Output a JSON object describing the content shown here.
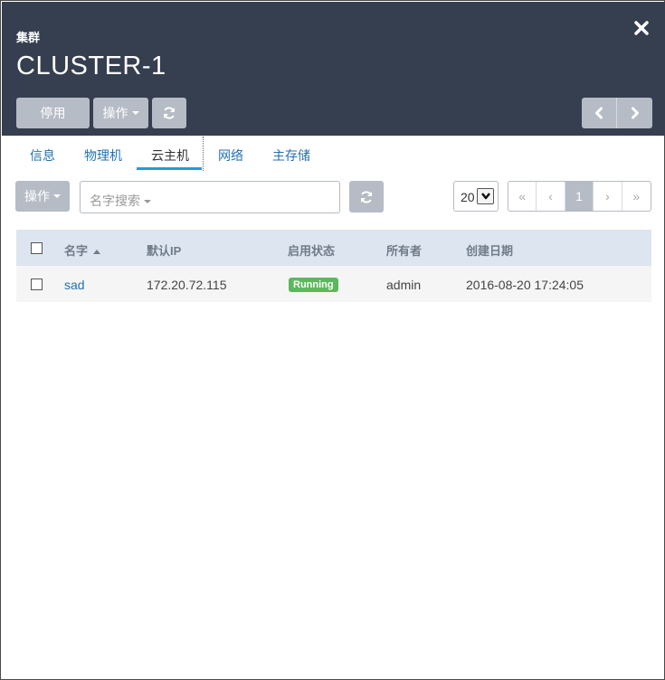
{
  "header": {
    "subtitle": "集群",
    "title": "CLUSTER-1",
    "disable_label": "停用",
    "actions_label": "操作",
    "bg_color": "#353f4f"
  },
  "tabs": [
    {
      "label": "信息",
      "active": false
    },
    {
      "label": "物理机",
      "active": false
    },
    {
      "label": "云主机",
      "active": true
    },
    {
      "label": "网络",
      "active": false
    },
    {
      "label": "主存储",
      "active": false
    }
  ],
  "toolbar": {
    "actions_label": "操作",
    "search_placeholder": "名字搜索",
    "page_size": "20"
  },
  "pagination": {
    "first": "«",
    "prev": "‹",
    "current": "1",
    "next": "›",
    "last": "»"
  },
  "table": {
    "columns": [
      "名字",
      "默认IP",
      "启用状态",
      "所有者",
      "创建日期"
    ],
    "sort_column": "名字",
    "rows": [
      {
        "name": "sad",
        "ip": "172.20.72.115",
        "status": "Running",
        "owner": "admin",
        "created": "2016-08-20 17:24:05"
      }
    ]
  },
  "colors": {
    "accent": "#1f9be0",
    "link": "#2372b0",
    "status_running": "#5cb85c",
    "button": "#b6bcc5",
    "table_header": "#dde5f0"
  }
}
